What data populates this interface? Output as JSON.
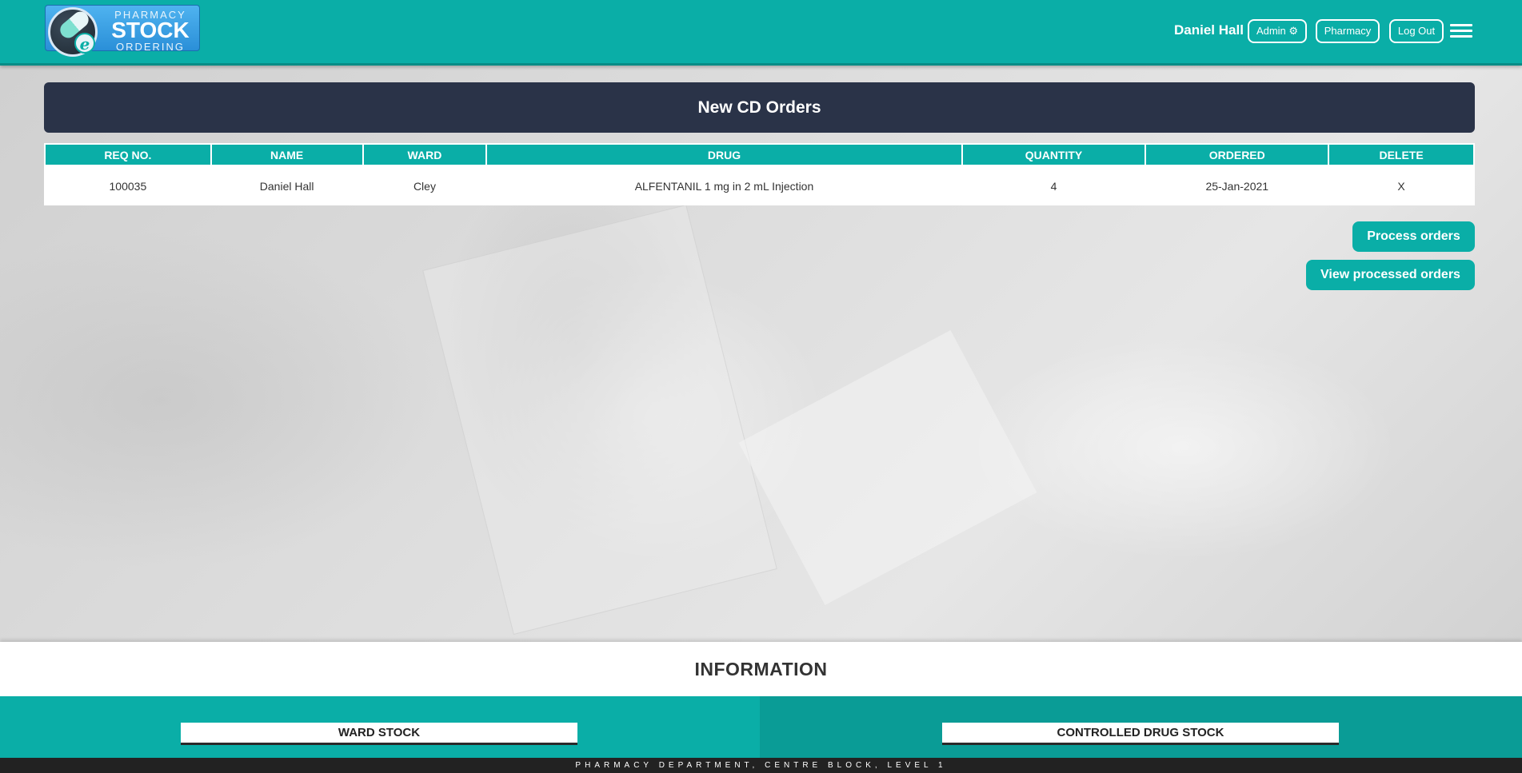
{
  "header": {
    "logo": {
      "line1": "PHARMACY",
      "line2": "STOCK",
      "line3": "ORDERING",
      "badge_letter": "e"
    },
    "user_name": "Daniel Hall",
    "admin_label": "Admin ⚙",
    "pharmacy_label": "Pharmacy",
    "logout_label": "Log Out",
    "menu_icon": "hamburger-menu-icon"
  },
  "page_title": "New CD Orders",
  "table": {
    "columns": [
      "REQ NO.",
      "NAME",
      "WARD",
      "DRUG",
      "QUANTITY",
      "ORDERED",
      "DELETE"
    ],
    "rows": [
      {
        "req_no": "100035",
        "name": "Daniel Hall",
        "ward": "Cley",
        "drug": "ALFENTANIL 1 mg in 2 mL Injection",
        "quantity": "4",
        "ordered": "25-Jan-2021",
        "delete": "X"
      }
    ]
  },
  "actions": {
    "process_label": "Process orders",
    "view_processed_label": "View processed orders"
  },
  "information": {
    "heading": "INFORMATION",
    "ward_stock_label": "WARD STOCK",
    "controlled_drug_stock_label": "CONTROLLED DRUG STOCK"
  },
  "footer": {
    "text": "PHARMACY DEPARTMENT, CENTRE BLOCK, LEVEL 1"
  },
  "colors": {
    "teal": "#0aaea7",
    "dark_navy": "#2a3348",
    "footer_bg": "#222222"
  }
}
